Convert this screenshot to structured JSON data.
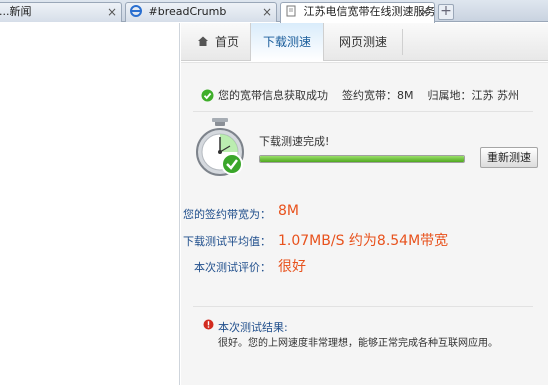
{
  "browser": {
    "tabs": [
      {
        "label": "...新闻",
        "close": "×"
      },
      {
        "label": "#breadCrumb",
        "close": "×"
      },
      {
        "label": "江苏电信宽带在线测速服务...",
        "close": "×"
      }
    ],
    "new_tab_label": "+"
  },
  "nav": {
    "home": "首页",
    "download_test": "下载测速",
    "web_test": "网页测速"
  },
  "info": {
    "status": "您的宽带信息获取成功",
    "contract_label": "签约宽带：",
    "contract_value": "8M",
    "location_label": "归属地：",
    "location_value": "江苏 苏州"
  },
  "test": {
    "done_text": "下载测速完成!",
    "progress": 1.0,
    "retest_button": "重新测速"
  },
  "results": {
    "contract_label": "您的签约带宽为：",
    "contract_value": "8M",
    "avg_label": "下载测试平均值：",
    "avg_value": "1.07MB/S 约为8.54M带宽",
    "rating_label": "本次测试评价：",
    "rating_value": "很好"
  },
  "summary": {
    "title": "本次测试结果:",
    "text": "很好。您的上网速度非常理想，能够正常完成各种互联网应用。"
  },
  "colors": {
    "accent_orange": "#e8521d",
    "label_blue": "#1f4e8c",
    "progress_green": "#4fa81f"
  }
}
